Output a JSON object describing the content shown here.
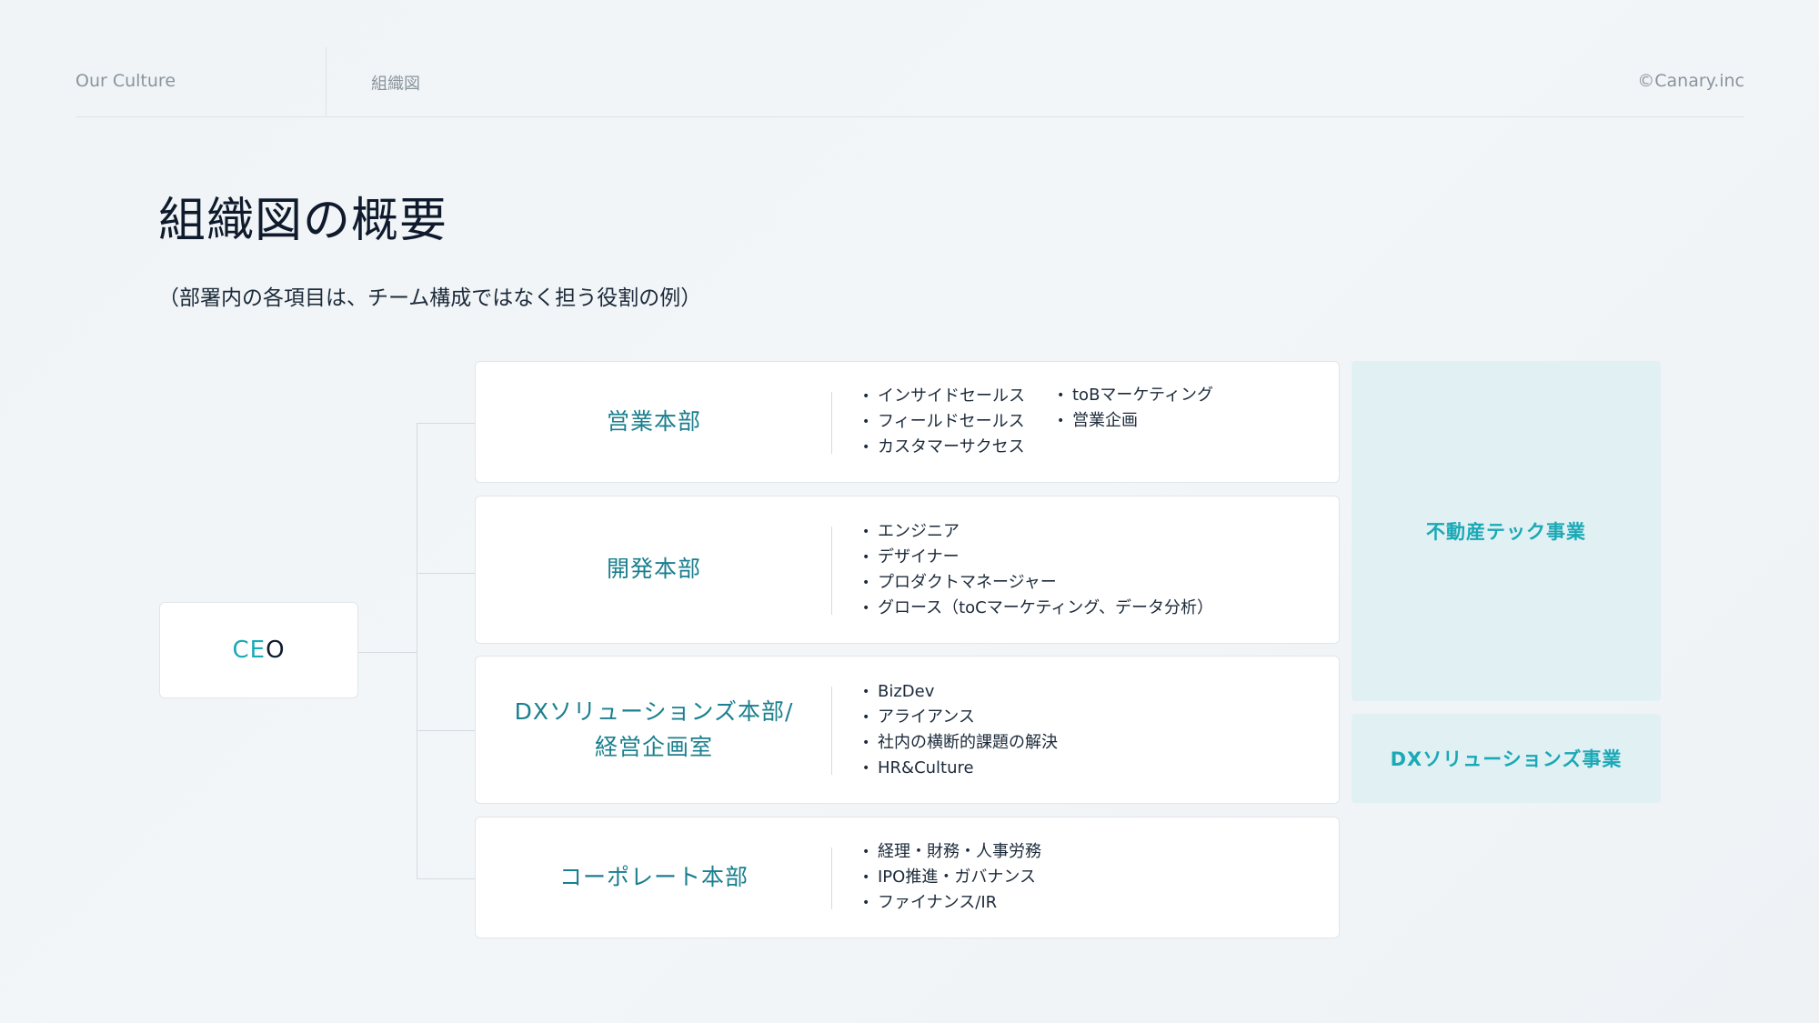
{
  "header": {
    "section": "Our Culture",
    "breadcrumb": "組織図",
    "copyright": "©Canary.inc"
  },
  "title": "組織図の概要",
  "subtitle": "（部署内の各項目は、チーム構成ではなく担う役割の例）",
  "ceo": {
    "part1": "CE",
    "part2": "O"
  },
  "departments": [
    {
      "name": "営業本部",
      "roles_col1": [
        "インサイドセールス",
        "フィールドセールス",
        "カスタマーサクセス"
      ],
      "roles_col2": [
        "toBマーケティング",
        "営業企画"
      ]
    },
    {
      "name": "開発本部",
      "roles_col1": [
        "エンジニア",
        "デザイナー",
        "プロダクトマネージャー",
        "グロース（toCマーケティング、データ分析）"
      ]
    },
    {
      "name": "DXソリューションズ本部/\n経営企画室",
      "roles_col1": [
        "BizDev",
        "アライアンス",
        "社内の横断的課題の解決",
        "HR&Culture"
      ]
    },
    {
      "name": "コーポレート本部",
      "roles_col1": [
        "経理・財務・人事労務",
        "IPO推進・ガバナンス",
        "ファイナンス/IR"
      ]
    }
  ],
  "businesses": {
    "fudosan_tech": "不動産テック事業",
    "dx_solutions": "DXソリューションズ事業"
  },
  "colors": {
    "accent": "#1aa9b6",
    "dept_name": "#1a7f8e",
    "biz_bg": "#e1f0f3",
    "title": "#0f1b2d"
  }
}
